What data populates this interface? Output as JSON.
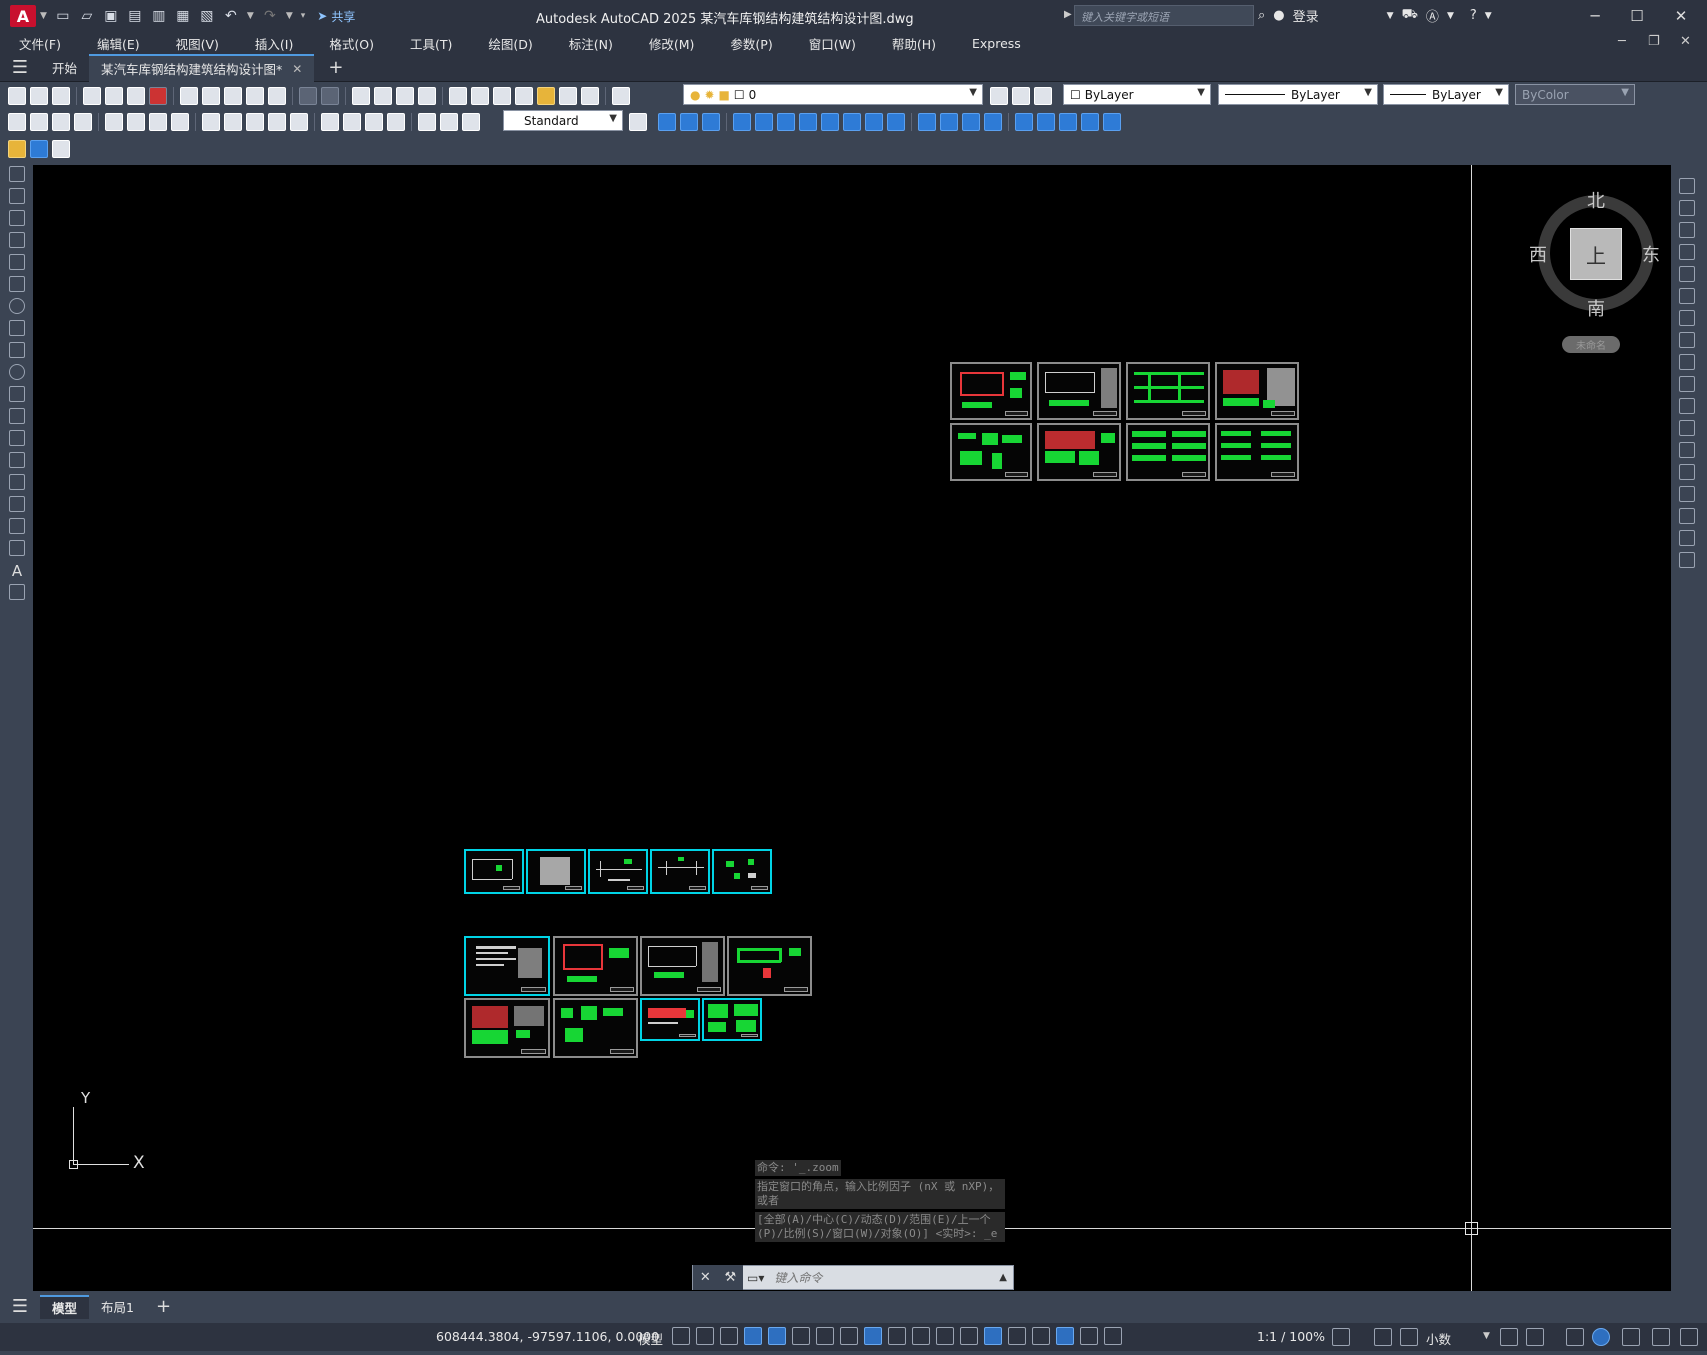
{
  "app": {
    "title": "Autodesk AutoCAD 2025    某汽车库钢结构建筑结构设计图.dwg",
    "logo_letter": "A",
    "share_label": "共享",
    "search_placeholder": "键入关键字或短语",
    "login_label": "登录"
  },
  "menu": [
    "文件(F)",
    "编辑(E)",
    "视图(V)",
    "插入(I)",
    "格式(O)",
    "工具(T)",
    "绘图(D)",
    "标注(N)",
    "修改(M)",
    "参数(P)",
    "窗口(W)",
    "帮助(H)",
    "Express"
  ],
  "tabs": {
    "start": "开始",
    "active": "某汽车库钢结构建筑结构设计图*"
  },
  "toolbar": {
    "layer_value": "0",
    "color_value": "ByLayer",
    "linetype_value": "ByLayer",
    "lineweight_value": "ByLayer",
    "plotstyle_value": "ByColor",
    "dimstyle_value": "Standard"
  },
  "viewcube": {
    "north": "北",
    "south": "南",
    "east": "东",
    "west": "西",
    "face": "上",
    "wcs": "未命名"
  },
  "ucs": {
    "x": "X",
    "y": "Y"
  },
  "command": {
    "history": [
      "命令: '_.zoom",
      "指定窗口的角点，输入比例因子 (nX 或 nXP)，或者",
      "[全部(A)/中心(C)/动态(D)/范围(E)/上一个(P)/比例(S)/窗口(W)/对象(O)] <实时>: _e"
    ],
    "placeholder": "键入命令"
  },
  "layout_tabs": {
    "model": "模型",
    "layout1": "布局1"
  },
  "status": {
    "coords": "608444.3804, -97597.1106, 0.0000",
    "space": "模型",
    "scale": "1:1 / 100%",
    "units": "小数"
  }
}
